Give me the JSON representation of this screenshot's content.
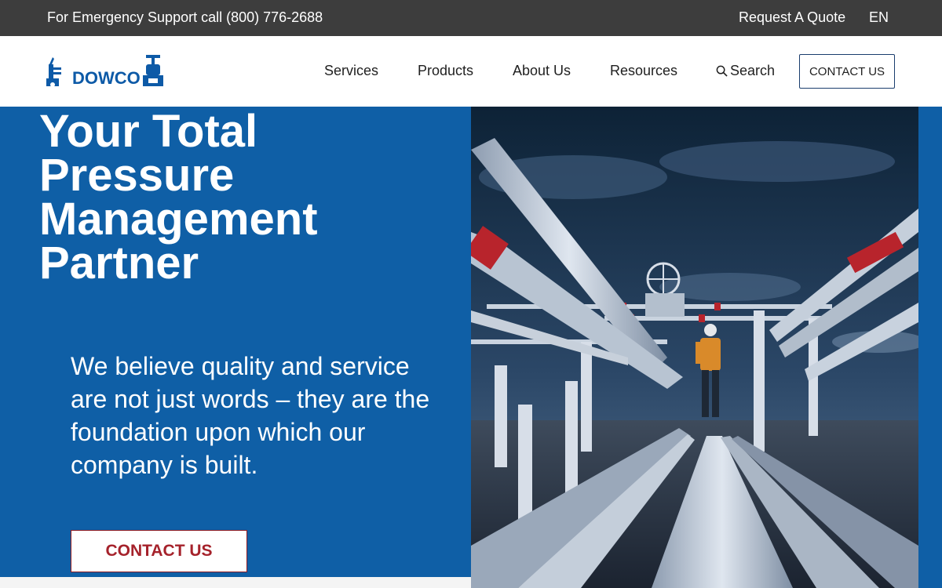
{
  "topbar": {
    "emergency_text": "For Emergency Support call (800) 776-2688",
    "quote_link": "Request A Quote",
    "language": "EN"
  },
  "header": {
    "logo_text": "DOWCO",
    "nav": {
      "services": "Services",
      "products": "Products",
      "about": "About Us",
      "resources": "Resources",
      "search": "Search"
    },
    "contact_button": "CONTACT US"
  },
  "hero": {
    "title_lines": [
      "Your Total",
      "Pressure",
      "Management",
      "Partner"
    ],
    "body": "We believe quality and service are not just words – they are the foundation upon which our company is built.",
    "cta": "CONTACT US"
  },
  "colors": {
    "brand_blue": "#0f5fa6",
    "topbar_bg": "#3d3d3d",
    "cta_red": "#a5222b"
  },
  "icons": {
    "search": "search-icon",
    "logo": "valve-logo-icon"
  }
}
